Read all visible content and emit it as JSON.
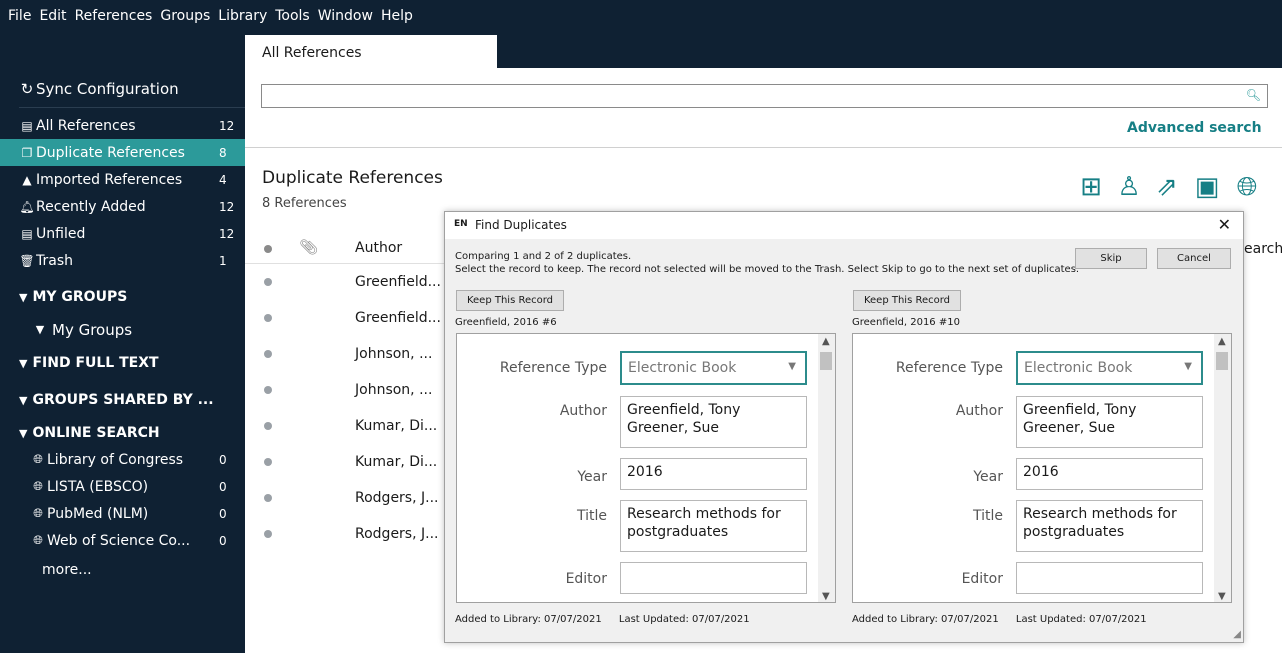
{
  "menubar": {
    "items": [
      "File",
      "Edit",
      "References",
      "Groups",
      "Library",
      "Tools",
      "Window",
      "Help"
    ]
  },
  "sidebar": {
    "sync": "Sync Configuration",
    "items": [
      {
        "icon": "all-references-icon",
        "label": "All References",
        "count": "12"
      },
      {
        "icon": "duplicate-icon",
        "label": "Duplicate References",
        "count": "8"
      },
      {
        "icon": "imported-icon",
        "label": "Imported References",
        "count": "4"
      },
      {
        "icon": "bell-icon",
        "label": "Recently Added",
        "count": "12"
      },
      {
        "icon": "unfiled-icon",
        "label": "Unfiled",
        "count": "12"
      },
      {
        "icon": "trash-icon",
        "label": "Trash",
        "count": "1"
      }
    ],
    "my_groups": "MY GROUPS",
    "my_groups_sub": "My Groups",
    "find_full_text": "FIND FULL TEXT",
    "groups_shared": "GROUPS SHARED BY ...",
    "online_search": "ONLINE SEARCH",
    "online": [
      {
        "label": "Library of Congress",
        "count": "0"
      },
      {
        "label": "LISTA (EBSCO)",
        "count": "0"
      },
      {
        "label": "PubMed (NLM)",
        "count": "0"
      },
      {
        "label": "Web of Science Co...",
        "count": "0"
      }
    ],
    "more": "more..."
  },
  "tabs": {
    "active": "All References"
  },
  "search": {
    "placeholder": "",
    "advanced": "Advanced search"
  },
  "library": {
    "title": "Duplicate References",
    "count": "8 References"
  },
  "list": {
    "author_header": "Author",
    "search_header": "earch",
    "rows": [
      "Greenfield...",
      "Greenfield...",
      "Johnson, ...",
      "Johnson, ...",
      "Kumar, Di...",
      "Kumar, Di...",
      "Rodgers, J...",
      "Rodgers, J..."
    ]
  },
  "dialog": {
    "logo": "EN",
    "title": "Find Duplicates",
    "close": "✕",
    "comparing": "Comparing 1 and 2 of 2 duplicates.",
    "instructions": "Select the record to keep. The record not selected will be moved to the Trash. Select Skip to go to the next set of duplicates.",
    "skip": "Skip",
    "cancel": "Cancel",
    "keep": "Keep This Record",
    "labels": {
      "type": "Reference Type",
      "author": "Author",
      "year": "Year",
      "title": "Title",
      "editor": "Editor"
    },
    "left": {
      "header": "Greenfield, 2016 #6",
      "type": "Electronic Book",
      "author1": "Greenfield, Tony",
      "author2": "Greener, Sue",
      "year": "2016",
      "title1": "Research methods for",
      "title2": "postgraduates",
      "added": "Added to Library: 07/07/2021",
      "updated": "Last Updated: 07/07/2021"
    },
    "right": {
      "header": "Greenfield, 2016 #10",
      "type": "Electronic Book",
      "author1": "Greenfield, Tony",
      "author2": "Greener, Sue",
      "year": "2016",
      "title1": "Research methods for",
      "title2": "postgraduates",
      "added": "Added to Library: 07/07/2021",
      "updated": "Last Updated: 07/07/2021"
    }
  },
  "colors": {
    "sidebar_bg": "#0f2133",
    "accent": "#2c9a9a",
    "link": "#167f85"
  }
}
